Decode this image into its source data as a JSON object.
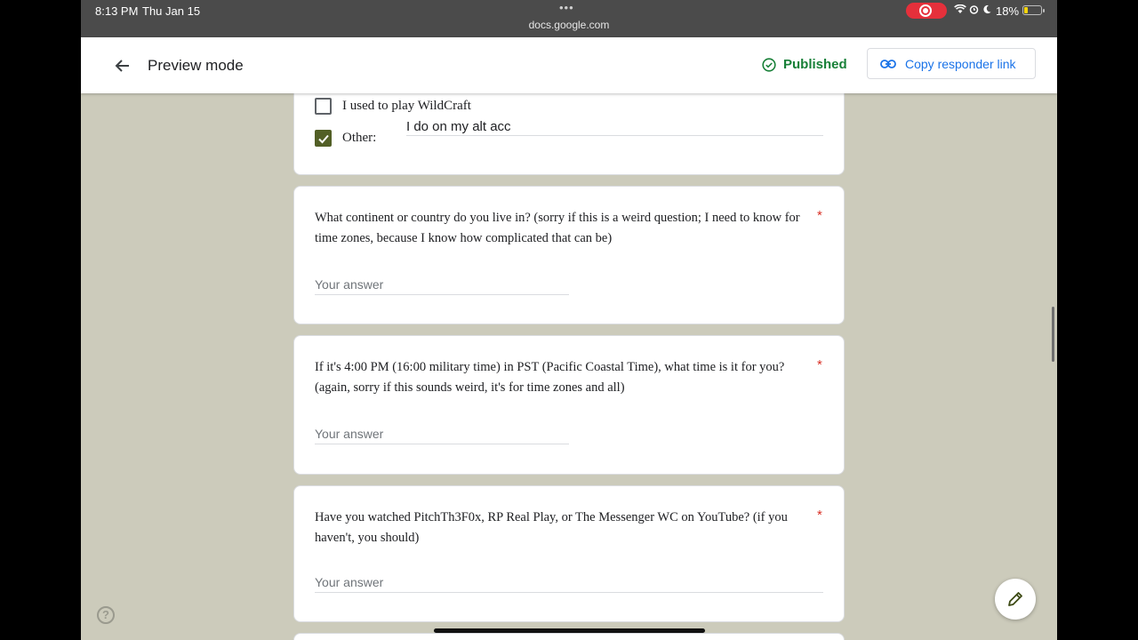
{
  "status": {
    "time": "8:13 PM",
    "date": "Thu Jan 15",
    "url": "docs.google.com",
    "battery": "18%"
  },
  "header": {
    "title": "Preview mode",
    "status": "Published",
    "copy_link": "Copy responder link"
  },
  "options": [
    {
      "label": "I used to play WildCraft",
      "checked": false
    },
    {
      "label": "Other:",
      "checked": true,
      "value": "I do on my alt acc"
    }
  ],
  "questions": [
    {
      "text": "What continent or country do you live in? (sorry if this is a weird question; I need to know for time zones, because I know how complicated that can be)",
      "required": "*",
      "placeholder": "Your answer"
    },
    {
      "text": "If it's 4:00 PM (16:00 military time) in PST (Pacific Coastal Time), what time is it for you? (again, sorry if this sounds weird, it's for time zones and all)",
      "required": "*",
      "placeholder": "Your answer"
    },
    {
      "text": "Have you watched PitchTh3F0x, RP Real Play, or The Messenger WC on YouTube? (if you haven't, you should)",
      "required": "*",
      "placeholder": "Your answer"
    }
  ],
  "help": "?"
}
